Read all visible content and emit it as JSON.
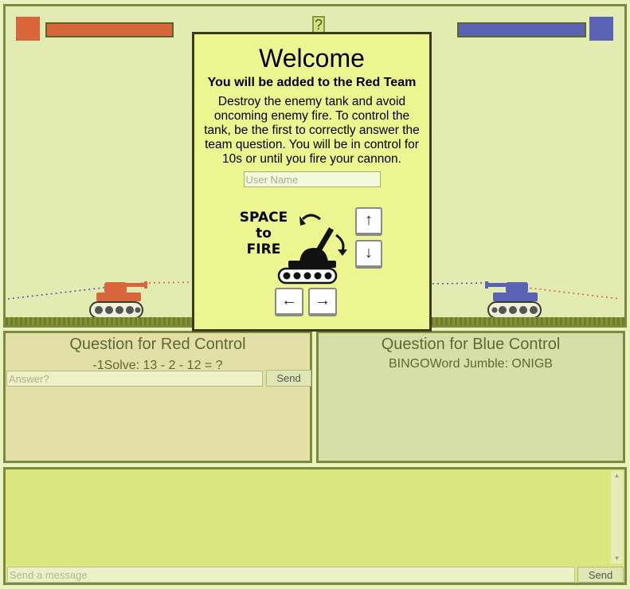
{
  "colors": {
    "red_team": "#d8663a",
    "blue_team": "#5a63b3",
    "modal_bg": "#ecf58f"
  },
  "health": {
    "red_level": 1.0,
    "blue_level": 1.0
  },
  "help_label": "?",
  "modal": {
    "title": "Welcome",
    "team_notice": "You will be added to the Red Team",
    "instructions": "Destroy the enemy tank and avoid oncoming enemy fire. To control the tank, be the first to correctly answer the team question. You will be in control for 10s or until you fire your cannon.",
    "username_placeholder": "User Name",
    "fire_hint_line1": "SPACE",
    "fire_hint_line2": "to",
    "fire_hint_line3": "FIRE",
    "keys": {
      "up": "↑",
      "down": "↓",
      "left": "←",
      "right": "→"
    }
  },
  "red_panel": {
    "title": "Question for Red Control",
    "question": "-1Solve: 13 - 2 - 12 = ?",
    "answer_placeholder": "Answer?",
    "send_label": "Send"
  },
  "blue_panel": {
    "title": "Question for Blue Control",
    "question": "BINGOWord Jumble: ONIGB"
  },
  "chat": {
    "placeholder": "Send a message",
    "send_label": "Send"
  }
}
